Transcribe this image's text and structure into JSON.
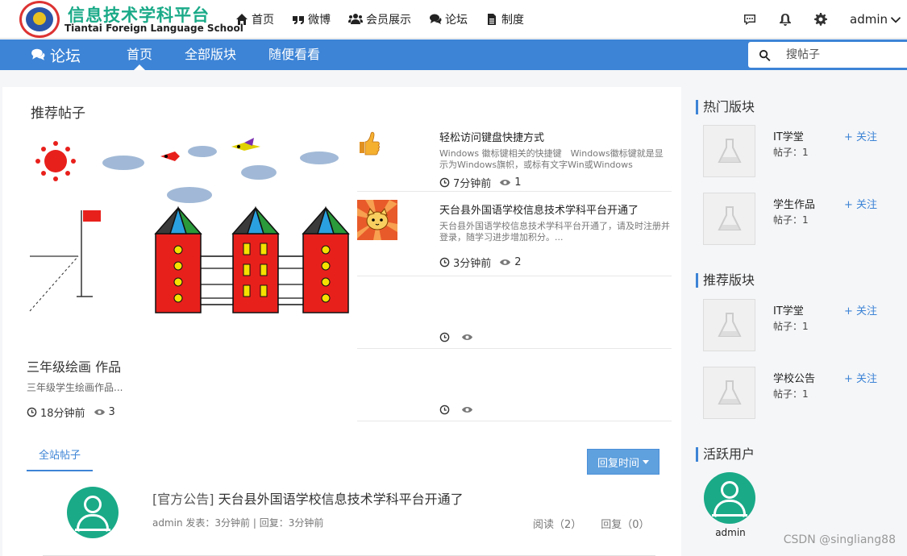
{
  "logo": {
    "cn": "信息技术学科平台",
    "en": "Tiantai Foreign Language School"
  },
  "menu": [
    {
      "label": "首页",
      "icon": "home-icon"
    },
    {
      "label": "微博",
      "icon": "quote-icon"
    },
    {
      "label": "会员展示",
      "icon": "users-icon"
    },
    {
      "label": "论坛",
      "icon": "comments-icon"
    },
    {
      "label": "制度",
      "icon": "document-icon"
    }
  ],
  "user": {
    "name": "admin"
  },
  "subnav": {
    "title": "论坛",
    "links": [
      "首页",
      "全部版块",
      "随便看看"
    ]
  },
  "search": {
    "placeholder": "搜帖子"
  },
  "recommended": {
    "title": "推荐帖子",
    "featured": {
      "title": "三年级绘画 作品",
      "desc": "三年级学生绘画作品...",
      "time": "18分钟前",
      "views": "3"
    },
    "posts": [
      {
        "title": "轻松访问键盘快捷方式",
        "desc": "Windows 徽标键相关的快捷键　Windows徽标键就是显示为Windows旗帜，或标有文字Win或Windows",
        "time": "7分钟前",
        "views": "1",
        "thumb": "thumbs-up-icon"
      },
      {
        "title": "天台县外国语学校信息技术学科平台开通了",
        "desc": "天台县外国语学校信息技术学科平台开通了，请及时注册并登录，随学习进步增加积分。...",
        "time": "3分钟前",
        "views": "2",
        "thumb": "cartoon-cat-image"
      },
      {
        "title": "",
        "desc": "",
        "time": "",
        "views": ""
      },
      {
        "title": "",
        "desc": "",
        "time": "",
        "views": ""
      }
    ]
  },
  "threads": {
    "tab": "全站帖子",
    "sort": "回复时间",
    "items": [
      {
        "tag": "[官方公告]",
        "title": "天台县外国语学校信息技术学科平台开通了",
        "info": "admin 发表：3分钟前 | 回复：3分钟前",
        "reads": "阅读（2）",
        "replies": "回复（0）"
      }
    ]
  },
  "sidebar": {
    "hot": {
      "title": "热门版块",
      "items": [
        {
          "name": "IT学堂",
          "count": "帖子：1",
          "follow": "+ 关注"
        },
        {
          "name": "学生作品",
          "count": "帖子：1",
          "follow": "+ 关注"
        }
      ]
    },
    "recommended": {
      "title": "推荐版块",
      "items": [
        {
          "name": "IT学堂",
          "count": "帖子：1",
          "follow": "+ 关注"
        },
        {
          "name": "学校公告",
          "count": "帖子：1",
          "follow": "+ 关注"
        }
      ]
    },
    "active": {
      "title": "活跃用户",
      "users": [
        {
          "name": "admin"
        }
      ]
    }
  },
  "watermark": "CSDN @singliang88",
  "colors": {
    "primary": "#3d84d6",
    "avatar": "#1aaa88",
    "logo_text": "#1aaa88"
  }
}
